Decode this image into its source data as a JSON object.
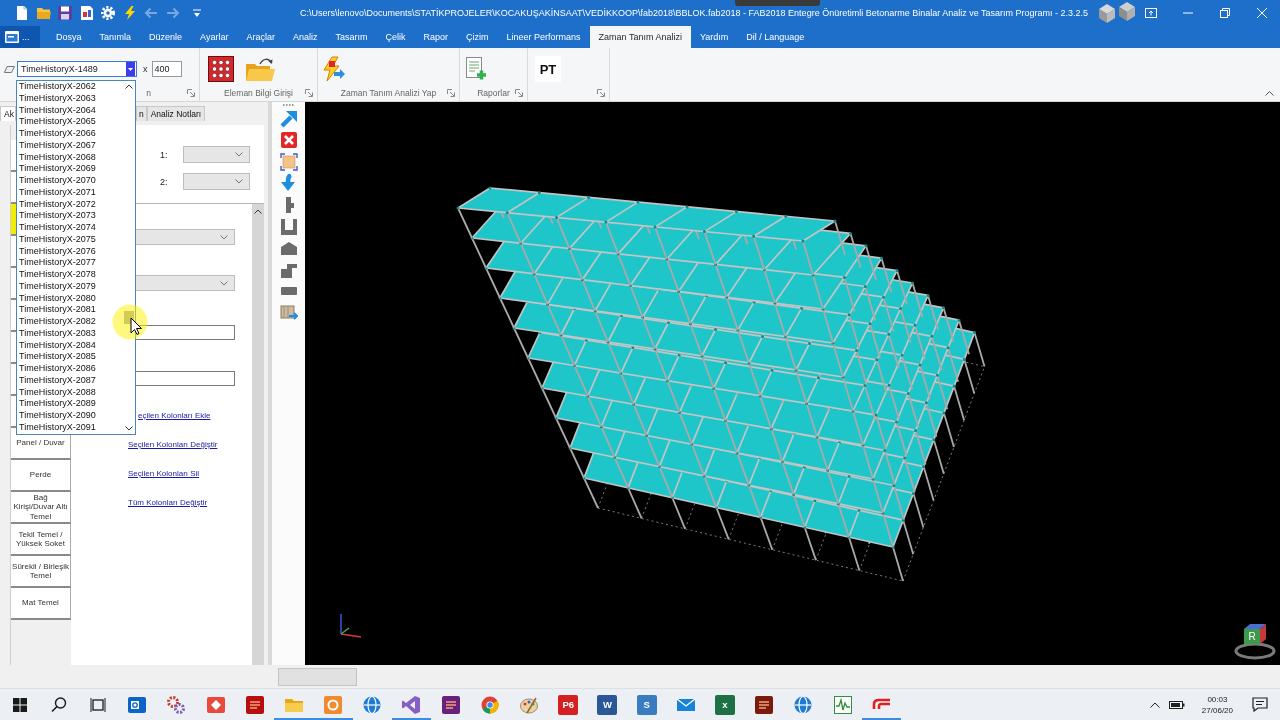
{
  "title_bar": {
    "quick_access": [
      {
        "kind": "new",
        "disabled": false
      },
      {
        "kind": "open",
        "disabled": false
      },
      {
        "kind": "save",
        "disabled": false
      },
      {
        "kind": "export",
        "disabled": false
      },
      {
        "kind": "settings",
        "disabled": false
      },
      {
        "kind": "run",
        "disabled": false
      },
      {
        "kind": "back",
        "disabled": true
      },
      {
        "kind": "forward",
        "disabled": true
      },
      {
        "kind": "customize",
        "disabled": false
      }
    ],
    "title": "C:\\Users\\lenovo\\Documents\\STATİKPROJELER\\KOCAKUŞAKİNSAAT\\VEDİKKOOP\\fab2018\\BBLOK.fab2018 - FAB2018 Entegre Önüretimli Betonarme Binalar Analiz ve Tasarım Programı - 2.3.2.5"
  },
  "menu": {
    "app_button": "...",
    "tabs": [
      {
        "label": "Dosya",
        "selected": false
      },
      {
        "label": "Tanımla",
        "selected": false
      },
      {
        "label": "Düzenle",
        "selected": false
      },
      {
        "label": "Ayarlar",
        "selected": false
      },
      {
        "label": "Araçlar",
        "selected": false
      },
      {
        "label": "Analiz",
        "selected": false
      },
      {
        "label": "Tasarım",
        "selected": false
      },
      {
        "label": "Çelik",
        "selected": false
      },
      {
        "label": "Rapor",
        "selected": false
      },
      {
        "label": "Çizim",
        "selected": false
      },
      {
        "label": "Lineer Performans",
        "selected": false
      },
      {
        "label": "Zaman Tanım Analizi",
        "selected": true
      },
      {
        "label": "Yardım",
        "selected": false
      },
      {
        "label": "Dil / Language",
        "selected": false
      }
    ]
  },
  "ribbon": {
    "series_combo": {
      "value": "TimeHistoryX-1489"
    },
    "scale_label": "x",
    "scale_field": {
      "value": "400"
    },
    "first_group_label": "n",
    "groups": [
      {
        "label": "Eleman Bilgi Girişi"
      },
      {
        "label": "Zaman Tanım Analizi Yap"
      },
      {
        "label": "Raporlar"
      }
    ],
    "pt_button": "PT"
  },
  "series_list": {
    "items": [
      {
        "label": "TimeHistoryX-2062",
        "selected": false
      },
      {
        "label": "TimeHistoryX-2063",
        "selected": false
      },
      {
        "label": "TimeHistoryX-2064",
        "selected": false
      },
      {
        "label": "TimeHistoryX-2065",
        "selected": false
      },
      {
        "label": "TimeHistoryX-2066",
        "selected": false
      },
      {
        "label": "TimeHistoryX-2067",
        "selected": false
      },
      {
        "label": "TimeHistoryX-2068",
        "selected": false
      },
      {
        "label": "TimeHistoryX-2069",
        "selected": false
      },
      {
        "label": "TimeHistoryX-2070",
        "selected": false
      },
      {
        "label": "TimeHistoryX-2071",
        "selected": false
      },
      {
        "label": "TimeHistoryX-2072",
        "selected": false
      },
      {
        "label": "TimeHistoryX-2073",
        "selected": false
      },
      {
        "label": "TimeHistoryX-2074",
        "selected": false
      },
      {
        "label": "TimeHistoryX-2075",
        "selected": false
      },
      {
        "label": "TimeHistoryX-2076",
        "selected": false
      },
      {
        "label": "TimeHistoryX-2077",
        "selected": false
      },
      {
        "label": "TimeHistoryX-2078",
        "selected": false
      },
      {
        "label": "TimeHistoryX-2079",
        "selected": false
      },
      {
        "label": "TimeHistoryX-2080",
        "selected": false
      },
      {
        "label": "TimeHistoryX-2081",
        "selected": false
      },
      {
        "label": "TimeHistoryX-2082",
        "selected": false
      },
      {
        "label": "TimeHistoryX-2083",
        "selected": false
      },
      {
        "label": "TimeHistoryX-2084",
        "selected": false
      },
      {
        "label": "TimeHistoryX-2085",
        "selected": false
      },
      {
        "label": "TimeHistoryX-2086",
        "selected": false
      },
      {
        "label": "TimeHistoryX-2087",
        "selected": false
      },
      {
        "label": "TimeHistoryX-2088",
        "selected": false
      },
      {
        "label": "TimeHistoryX-2089",
        "selected": false
      },
      {
        "label": "TimeHistoryX-2090",
        "selected": false
      },
      {
        "label": "TimeHistoryX-2091",
        "selected": false
      }
    ]
  },
  "left_panel": {
    "tabs": [
      {
        "label": "Ak",
        "selected": true
      },
      {
        "label": "n",
        "selected": false
      },
      {
        "label": "Analiz Notları",
        "selected": false
      }
    ],
    "element_buttons": [
      {
        "selected": false
      },
      {
        "selected": false
      },
      {
        "selected": true
      },
      {
        "selected": false
      },
      {
        "selected": false
      },
      {
        "selected": false
      },
      {
        "selected": false
      },
      {
        "selected": false
      },
      {
        "selected": false
      },
      {
        "label": "Panel / Duvar",
        "selected": false
      },
      {
        "label": "Perde",
        "selected": false
      },
      {
        "label": "Bağ Kirişi/Duvar Altı Temel",
        "selected": false
      },
      {
        "label": "Tekil Temel / Yüksek Soket",
        "selected": false
      },
      {
        "label": "Sürekli / Birleşik Temel",
        "selected": false
      },
      {
        "label": "Mat Temel",
        "selected": false
      }
    ],
    "selectors": [
      {
        "label": "1:"
      },
      {
        "label": "2:"
      }
    ],
    "links": [
      "eçilen Kolonları Ekle",
      "Seçilen Kolonları Değiştir",
      "Seçilen Kolonları Sil",
      "Tüm Kolonları Değiştir"
    ]
  },
  "viewport": {
    "view_cube": {
      "face_label": "R"
    }
  },
  "taskbar": {
    "apps": [
      {
        "kind": "start",
        "running": false
      },
      {
        "kind": "search",
        "running": false
      },
      {
        "kind": "taskview",
        "running": false
      },
      {
        "kind": "outlook",
        "running": false
      },
      {
        "kind": "gears",
        "running": false
      },
      {
        "kind": "diamond",
        "running": false
      },
      {
        "kind": "filezilla",
        "running": false
      },
      {
        "kind": "explorer",
        "running": true
      },
      {
        "kind": "orange",
        "running": true
      },
      {
        "kind": "globe",
        "running": false
      },
      {
        "kind": "vs",
        "running": true
      },
      {
        "kind": "vspurple",
        "running": false
      },
      {
        "kind": "chrome",
        "running": false
      },
      {
        "kind": "paint",
        "running": false
      },
      {
        "kind": "letter",
        "glyph": "P6",
        "running": false
      },
      {
        "kind": "letter",
        "glyph": "W",
        "running": false
      },
      {
        "kind": "letter",
        "glyph": "S",
        "running": false
      },
      {
        "kind": "mail",
        "running": false
      },
      {
        "kind": "letter",
        "glyph": "x",
        "running": false
      },
      {
        "kind": "darkred",
        "running": false
      },
      {
        "kind": "edge",
        "running": false
      },
      {
        "kind": "wave",
        "running": false
      },
      {
        "kind": "fab",
        "running": true
      }
    ],
    "time": "00:03",
    "date": "27/06/20"
  }
}
